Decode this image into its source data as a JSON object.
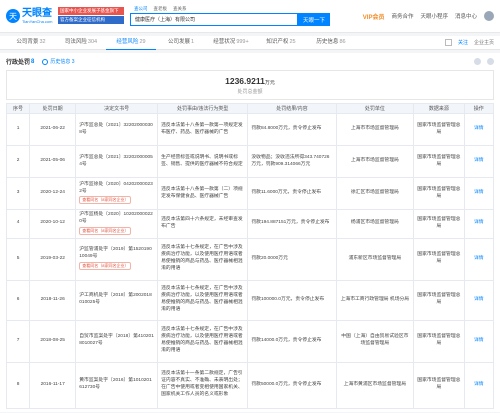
{
  "header": {
    "logo_symbol": "天",
    "logo_name": "天眼查",
    "logo_sub": "TianYanCha.com",
    "promo_line1": "国家中小企业发展子基金旗下",
    "promo_line2": "官方备案企业征信机构",
    "search_tabs": [
      "查公司",
      "查老板",
      "查关系"
    ],
    "search_value": "健康医疗（上海）有限公司",
    "search_button": "天眼一下",
    "vip": "VIP会员",
    "nav_items": [
      "商务合作",
      "天眼小程序",
      "消息中心"
    ]
  },
  "tabs": [
    {
      "label": "公司背景",
      "count": "32"
    },
    {
      "label": "司法风险",
      "count": "304"
    },
    {
      "label": "经营风险",
      "count": "29"
    },
    {
      "label": "公司发展",
      "count": "1"
    },
    {
      "label": "经营状况",
      "count": "999+"
    },
    {
      "label": "知识产权",
      "count": "25"
    },
    {
      "label": "历史信息",
      "count": "86"
    }
  ],
  "tab_right": {
    "follow": "关注",
    "tip": "企业主页"
  },
  "section": {
    "title": "行政处罚",
    "count": "8",
    "history": "历史信息 3"
  },
  "summary": {
    "amount": "1236.9211",
    "unit": "万元",
    "label": "处罚总金额"
  },
  "table": {
    "headers": [
      "序号",
      "处罚日期",
      "决定文书号",
      "处罚事由/违法行为类型",
      "处罚结果/内容",
      "处罚单位",
      "数据来源",
      "操作"
    ],
    "rows": [
      {
        "idx": "1",
        "date": "2021-06-22",
        "doc": "沪市监总处〔2021〕322020000308号",
        "badge": "",
        "reason": "违反本法第十八条第一款第一项规定发布医疗、药品、医疗器械的广告",
        "result": "罚款84.8000万元，责令停止发布",
        "org": "上海市市场监督管理局",
        "source": "国家市场监督管理总局",
        "op": "详情"
      },
      {
        "idx": "2",
        "date": "2021-05-06",
        "doc": "沪市监总处〔2021〕322020000054号",
        "badge": "",
        "reason": "生产经营标签或说明书、说明书或标签、销售、提供的医疗器械不符合规定",
        "result": "没收物品；没收违法所得343.740726万元，罚款909.314066万元",
        "org": "上海市市场监督管理局",
        "source": "国家市场监督管理总局",
        "op": "详情"
      },
      {
        "idx": "3",
        "date": "2020-12-24",
        "doc": "沪市监徐处〔2020〕042020000232号",
        "badge": "查看同名（8家同名企业）",
        "reason": "违反本法第十八条第一款第（二）项规定发布保健食品、医疗器械广告",
        "result": "罚款11.6000万元，责令停止发布",
        "org": "徐汇区市场监督管理局",
        "source": "国家市场监督管理总局",
        "op": "详情"
      },
      {
        "idx": "4",
        "date": "2020-10-12",
        "doc": "沪市监杨处〔2020〕102020000220号",
        "badge": "查看同名（8家同名企业）",
        "reason": "违反本法第四十六条规定，未经审查发布广告",
        "result": "罚款194.887151万元，责令停止发布",
        "org": "杨浦区市场监督管理局",
        "source": "国家市场监督管理总局",
        "op": "详情"
      },
      {
        "idx": "5",
        "date": "2019-03-22",
        "doc": "沪监管浦处字（2019）第152019010049号",
        "badge": "查看同名（8家同名企业）",
        "reason": "违反本法第十七条规定，在广告中涉及疾病治疗功能，以及使用医疗用语或者易使推销的商品与药品、医疗器械相混淆的用语",
        "result": "罚款20.0000万元",
        "org": "浦东新区市场监督管理局",
        "source": "国家市场监督管理总局",
        "op": "详情"
      },
      {
        "idx": "6",
        "date": "2018-11-26",
        "doc": "沪工商机处字〔2018〕第2002018010025号",
        "badge": "",
        "reason": "违反本法第十七条规定，在广告中涉及疾病治疗功能，以及使用医疗用语或者易使推销的商品与药品、医疗器械相混淆的用语",
        "result": "罚款100000.0万元，责令停止发布",
        "org": "上海市工商行政管理局 机场分局",
        "source": "国家市场监督管理总局",
        "op": "详情"
      },
      {
        "idx": "7",
        "date": "2018-08-25",
        "doc": "自贸市监案处字〔2018〕第4102018010027号",
        "badge": "",
        "reason": "违反本法第十七条规定，在广告中涉及疾病治疗功能，以及使用医疗用语或者易使推销的商品与药品、医疗器械相混淆的用语",
        "result": "罚款14000.0万元，责令停止发布",
        "org": "中国（上海）自由贸易试验区市场监督管理局",
        "source": "国家市场监督管理总局",
        "op": "详情"
      },
      {
        "idx": "8",
        "date": "2016-11-17",
        "doc": "黄市监案处字〔2016〕第1010201612730号",
        "badge": "",
        "reason": "违反本法第十一条第二款规定，广告引证内容不真实、不准确、未表明出处；在广告中使用或者变相使用国家机关、国家机关工作人员的名义或形象",
        "result": "罚款50000.0万元，责令停止发布",
        "org": "上海市黄浦区市场监督管理局",
        "source": "国家市场监督管理总局",
        "op": "详情"
      }
    ]
  }
}
